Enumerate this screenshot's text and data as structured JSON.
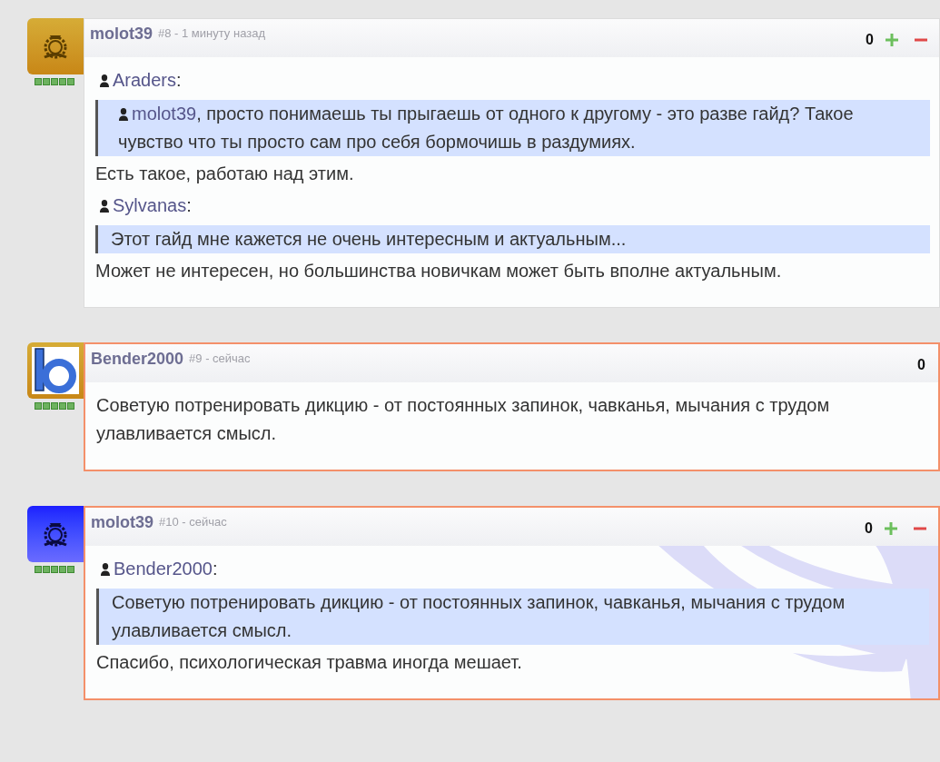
{
  "comments": [
    {
      "avatar": {
        "kind": "gold"
      },
      "author": "molot39",
      "meta": "#8 - 1 минуту назад",
      "score": "0",
      "voting": true,
      "highlighted": false,
      "watermark": false,
      "body": [
        {
          "kind": "quote_author",
          "name": "Araders",
          "suffix": ":"
        },
        {
          "kind": "quote",
          "mention": "molot39",
          "text": ", просто понимаешь ты прыгаешь от одного к другому - это разве гайд? Такое чувство что ты просто сам про себя бормочишь в раздумиях."
        },
        {
          "kind": "text",
          "text": "Есть такое, работаю над этим."
        },
        {
          "kind": "quote_author",
          "name": "Sylvanas",
          "suffix": ":"
        },
        {
          "kind": "quote",
          "text": "Этот гайд мне кажется не очень интересным и актуальным..."
        },
        {
          "kind": "text",
          "text": "Может не интересен, но большинства новичкам может быть вполне актуальным."
        }
      ]
    },
    {
      "avatar": {
        "kind": "logo"
      },
      "author": "Bender2000",
      "meta": "#9 - сейчас",
      "score": "0",
      "voting": false,
      "highlighted": true,
      "watermark": false,
      "body": [
        {
          "kind": "text",
          "text": "Советую потренировать дикцию - от постоянных запинок, чавканья, мычания с трудом улавливается смысл."
        }
      ]
    },
    {
      "avatar": {
        "kind": "blue"
      },
      "author": "molot39",
      "meta": "#10 - сейчас",
      "score": "0",
      "voting": true,
      "highlighted": true,
      "watermark": true,
      "body": [
        {
          "kind": "quote_author",
          "name": "Bender2000",
          "suffix": ":"
        },
        {
          "kind": "quote",
          "text": "Советую потренировать дикцию - от постоянных запинок, чавканья, мычания с трудом улавливается смысл."
        },
        {
          "kind": "text",
          "text": "Спасибо, психологическая травма иногда мешает."
        }
      ]
    }
  ]
}
